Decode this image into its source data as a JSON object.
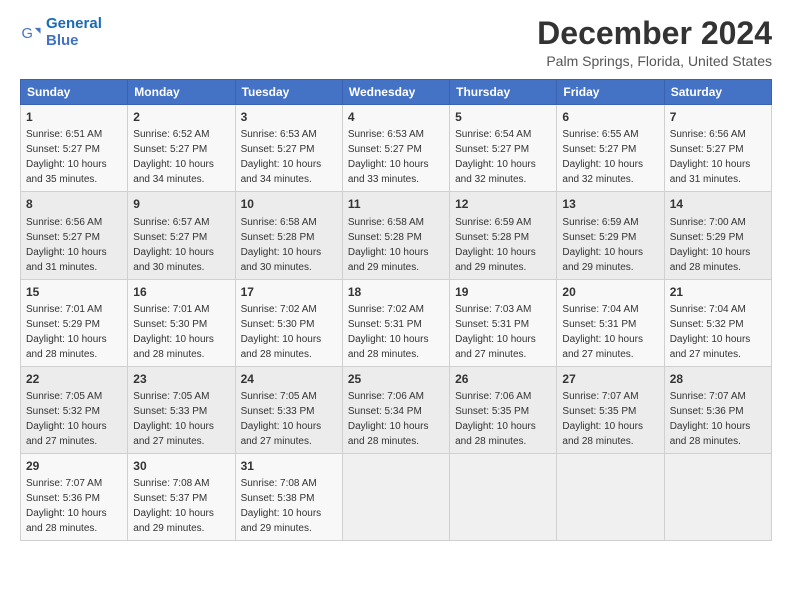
{
  "logo": {
    "text_general": "General",
    "text_blue": "Blue"
  },
  "header": {
    "month": "December 2024",
    "location": "Palm Springs, Florida, United States"
  },
  "weekdays": [
    "Sunday",
    "Monday",
    "Tuesday",
    "Wednesday",
    "Thursday",
    "Friday",
    "Saturday"
  ],
  "weeks": [
    [
      {
        "day": "1",
        "sunrise": "6:51 AM",
        "sunset": "5:27 PM",
        "daylight": "10 hours and 35 minutes."
      },
      {
        "day": "2",
        "sunrise": "6:52 AM",
        "sunset": "5:27 PM",
        "daylight": "10 hours and 34 minutes."
      },
      {
        "day": "3",
        "sunrise": "6:53 AM",
        "sunset": "5:27 PM",
        "daylight": "10 hours and 34 minutes."
      },
      {
        "day": "4",
        "sunrise": "6:53 AM",
        "sunset": "5:27 PM",
        "daylight": "10 hours and 33 minutes."
      },
      {
        "day": "5",
        "sunrise": "6:54 AM",
        "sunset": "5:27 PM",
        "daylight": "10 hours and 32 minutes."
      },
      {
        "day": "6",
        "sunrise": "6:55 AM",
        "sunset": "5:27 PM",
        "daylight": "10 hours and 32 minutes."
      },
      {
        "day": "7",
        "sunrise": "6:56 AM",
        "sunset": "5:27 PM",
        "daylight": "10 hours and 31 minutes."
      }
    ],
    [
      {
        "day": "8",
        "sunrise": "6:56 AM",
        "sunset": "5:27 PM",
        "daylight": "10 hours and 31 minutes."
      },
      {
        "day": "9",
        "sunrise": "6:57 AM",
        "sunset": "5:27 PM",
        "daylight": "10 hours and 30 minutes."
      },
      {
        "day": "10",
        "sunrise": "6:58 AM",
        "sunset": "5:28 PM",
        "daylight": "10 hours and 30 minutes."
      },
      {
        "day": "11",
        "sunrise": "6:58 AM",
        "sunset": "5:28 PM",
        "daylight": "10 hours and 29 minutes."
      },
      {
        "day": "12",
        "sunrise": "6:59 AM",
        "sunset": "5:28 PM",
        "daylight": "10 hours and 29 minutes."
      },
      {
        "day": "13",
        "sunrise": "6:59 AM",
        "sunset": "5:29 PM",
        "daylight": "10 hours and 29 minutes."
      },
      {
        "day": "14",
        "sunrise": "7:00 AM",
        "sunset": "5:29 PM",
        "daylight": "10 hours and 28 minutes."
      }
    ],
    [
      {
        "day": "15",
        "sunrise": "7:01 AM",
        "sunset": "5:29 PM",
        "daylight": "10 hours and 28 minutes."
      },
      {
        "day": "16",
        "sunrise": "7:01 AM",
        "sunset": "5:30 PM",
        "daylight": "10 hours and 28 minutes."
      },
      {
        "day": "17",
        "sunrise": "7:02 AM",
        "sunset": "5:30 PM",
        "daylight": "10 hours and 28 minutes."
      },
      {
        "day": "18",
        "sunrise": "7:02 AM",
        "sunset": "5:31 PM",
        "daylight": "10 hours and 28 minutes."
      },
      {
        "day": "19",
        "sunrise": "7:03 AM",
        "sunset": "5:31 PM",
        "daylight": "10 hours and 27 minutes."
      },
      {
        "day": "20",
        "sunrise": "7:04 AM",
        "sunset": "5:31 PM",
        "daylight": "10 hours and 27 minutes."
      },
      {
        "day": "21",
        "sunrise": "7:04 AM",
        "sunset": "5:32 PM",
        "daylight": "10 hours and 27 minutes."
      }
    ],
    [
      {
        "day": "22",
        "sunrise": "7:05 AM",
        "sunset": "5:32 PM",
        "daylight": "10 hours and 27 minutes."
      },
      {
        "day": "23",
        "sunrise": "7:05 AM",
        "sunset": "5:33 PM",
        "daylight": "10 hours and 27 minutes."
      },
      {
        "day": "24",
        "sunrise": "7:05 AM",
        "sunset": "5:33 PM",
        "daylight": "10 hours and 27 minutes."
      },
      {
        "day": "25",
        "sunrise": "7:06 AM",
        "sunset": "5:34 PM",
        "daylight": "10 hours and 28 minutes."
      },
      {
        "day": "26",
        "sunrise": "7:06 AM",
        "sunset": "5:35 PM",
        "daylight": "10 hours and 28 minutes."
      },
      {
        "day": "27",
        "sunrise": "7:07 AM",
        "sunset": "5:35 PM",
        "daylight": "10 hours and 28 minutes."
      },
      {
        "day": "28",
        "sunrise": "7:07 AM",
        "sunset": "5:36 PM",
        "daylight": "10 hours and 28 minutes."
      }
    ],
    [
      {
        "day": "29",
        "sunrise": "7:07 AM",
        "sunset": "5:36 PM",
        "daylight": "10 hours and 28 minutes."
      },
      {
        "day": "30",
        "sunrise": "7:08 AM",
        "sunset": "5:37 PM",
        "daylight": "10 hours and 29 minutes."
      },
      {
        "day": "31",
        "sunrise": "7:08 AM",
        "sunset": "5:38 PM",
        "daylight": "10 hours and 29 minutes."
      },
      null,
      null,
      null,
      null
    ]
  ]
}
